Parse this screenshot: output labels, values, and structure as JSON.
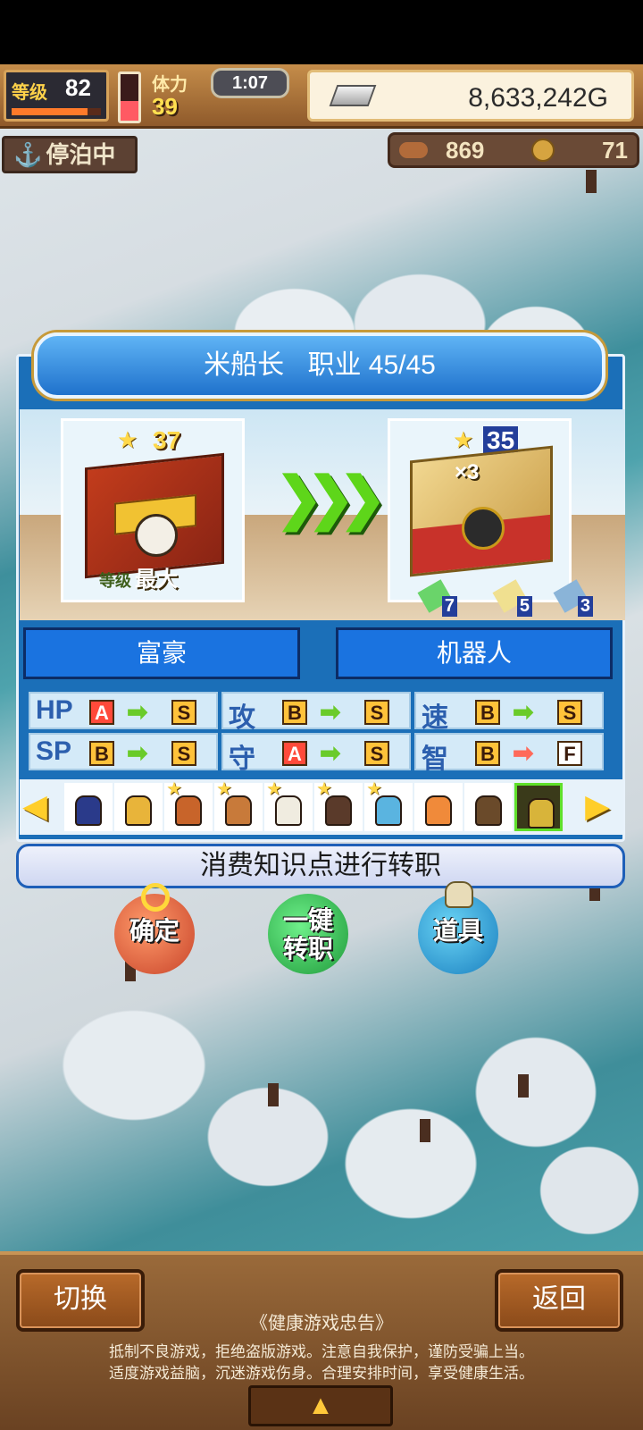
{
  "status": {
    "level_label": "等级",
    "level": "82",
    "level_progress": 0.85,
    "hp_fill": 0.42,
    "stamina_label": "体力",
    "stamina": "39",
    "time": "1:07",
    "gold": "8,633,242G",
    "anchor_label": "停泊中",
    "meat": "869",
    "medals": "71"
  },
  "dialog": {
    "character_name": "米船长",
    "job_label": "职业",
    "job_count": "45/45",
    "from": {
      "stars": "37",
      "level_label": "等级",
      "level_value": "最大"
    },
    "to": {
      "stars": "35",
      "coin_mult": "×3",
      "items": [
        {
          "icon": "sword-icon",
          "count": "7",
          "color": "#6ad46a"
        },
        {
          "icon": "lamp-icon",
          "count": "5",
          "color": "#f0e090"
        },
        {
          "icon": "gun-icon",
          "count": "3",
          "color": "#8ab4d8"
        }
      ]
    },
    "arrows": "❯❯❯",
    "jobs": {
      "current": "富豪",
      "next": "机器人"
    },
    "stats": [
      {
        "name": "HP",
        "from": "A",
        "to": "S",
        "dir": "up"
      },
      {
        "name": "攻",
        "from": "B",
        "to": "S",
        "dir": "up"
      },
      {
        "name": "速",
        "from": "B",
        "to": "S",
        "dir": "up"
      },
      {
        "name": "SP",
        "from": "B",
        "to": "S",
        "dir": "up"
      },
      {
        "name": "守",
        "from": "A",
        "to": "S",
        "dir": "up"
      },
      {
        "name": "智",
        "from": "B",
        "to": "F",
        "dir": "down"
      }
    ],
    "convert_text": "消费知识点进行转职"
  },
  "actions": {
    "confirm": "确定",
    "onekey_line1": "一键",
    "onekey_line2": "转职",
    "items": "道具"
  },
  "bottom": {
    "switch_label": "切换",
    "back_label": "返回",
    "advisory_title": "《健康游戏忠告》",
    "advisory_line1": "抵制不良游戏，拒绝盗版游戏。注意自我保护，谨防受骗上当。",
    "advisory_line2": "适度游戏益脑，沉迷游戏伤身。合理安排时间，享受健康生活。"
  },
  "colors": {
    "accent_blue": "#1a73e0",
    "grade_A": "#ff4a3a",
    "grade_B_S": "#ffc23a",
    "up_arrow": "#6acb2a",
    "down_arrow": "#ff6a5a"
  }
}
